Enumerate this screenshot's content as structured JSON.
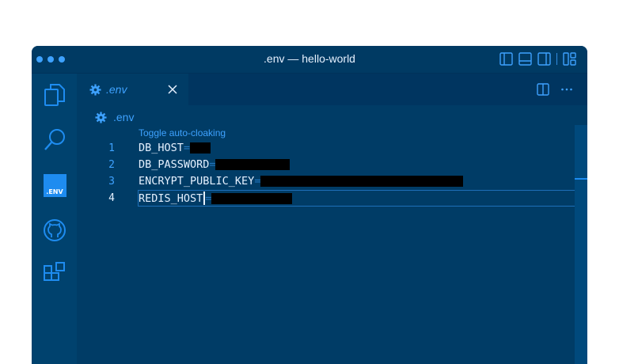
{
  "window": {
    "title": ".env — hello-world"
  },
  "activity_bar": {
    "items": [
      {
        "icon": "files-icon"
      },
      {
        "icon": "search-icon"
      },
      {
        "icon": "env-extension-icon",
        "label": ".ENV"
      },
      {
        "icon": "github-icon"
      },
      {
        "icon": "extensions-icon"
      }
    ]
  },
  "tab": {
    "label": ".env",
    "icon": "gear-icon"
  },
  "breadcrumb": {
    "label": ".env",
    "icon": "gear-icon"
  },
  "codelens": "Toggle auto-cloaking",
  "lines": [
    {
      "number": "1",
      "key": "DB_HOST"
    },
    {
      "number": "2",
      "key": "DB_PASSWORD"
    },
    {
      "number": "3",
      "key": "ENCRYPT_PUBLIC_KEY"
    },
    {
      "number": "4",
      "key": "REDIS_HOST"
    }
  ],
  "colors": {
    "background": "#003c66",
    "accent": "#3ea2ff",
    "text": "#e6f1ff",
    "cloak": "#000000"
  }
}
